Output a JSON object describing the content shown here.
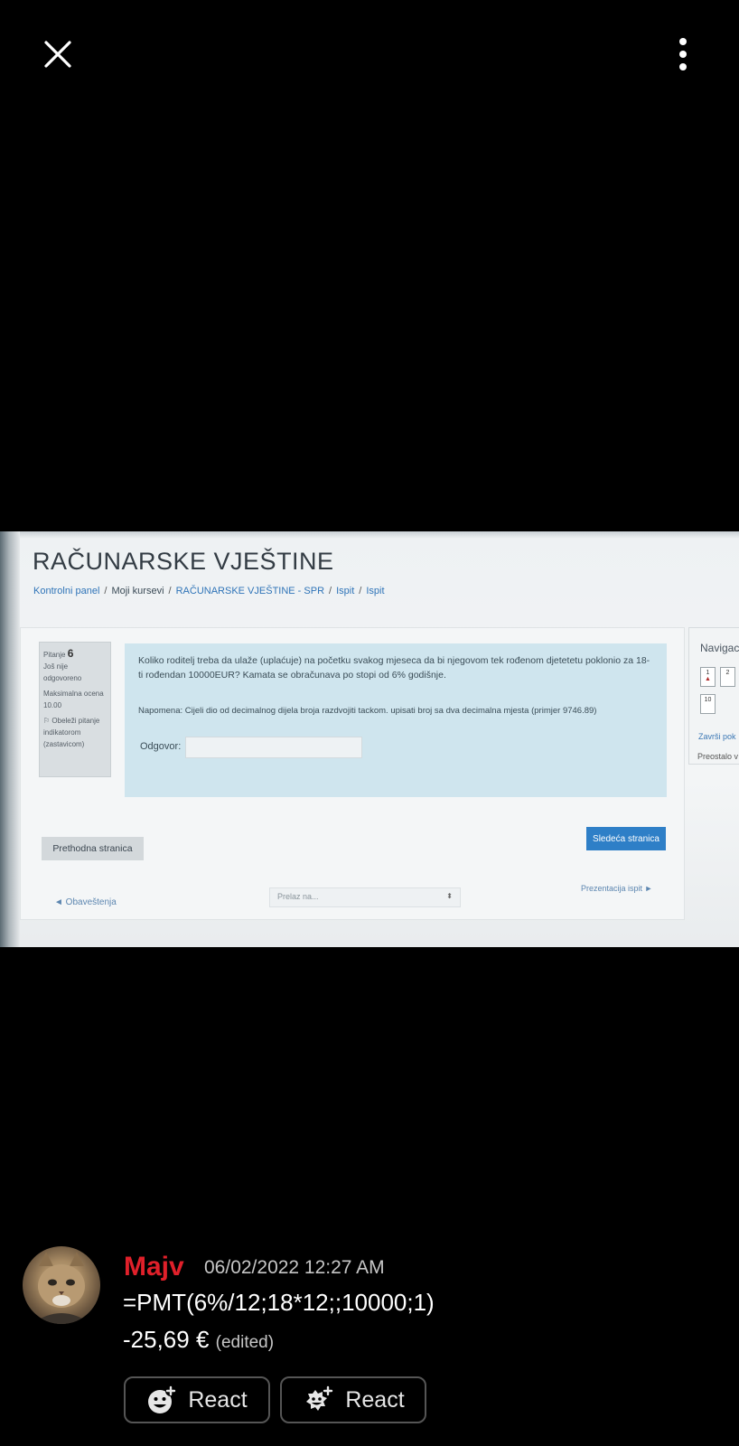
{
  "viewer": {
    "close_icon": "close-icon",
    "more_icon": "more-vertical-icon"
  },
  "screenshot": {
    "site_title": "RAČUNARSKE VJEŠTINE",
    "breadcrumb": {
      "items": [
        "Kontrolni panel",
        "Moji kursevi",
        "RAČUNARSKE VJEŠTINE - SPR",
        "Ispit",
        "Ispit"
      ],
      "separator": "/"
    },
    "question_info": {
      "label": "Pitanje",
      "number": "6",
      "status": "Još nije odgovoreno",
      "max_grade": "Maksimalna ocena 10.00",
      "flag_text": "Obeleži pitanje indikatorom (zastavicom)"
    },
    "question_text": "Koliko roditelj treba da ulaže (uplaćuje) na početku svakog mjeseca da bi njegovom tek rođenom djetetetu poklonio za 18-ti rođendan 10000EUR? Kamata se obračunava po stopi od 6% godišnje.",
    "note": "Napomena: Cijeli dio od decimalnog dijela broja razdvojiti tackom. upisati broj sa dva decimalna mjesta (primjer 9746.89)",
    "answer_label": "Odgovor:",
    "prev_button": "Prethodna stranica",
    "next_button": "Sledeća stranica",
    "prev_activity": "◄ Obaveštenja",
    "jump_placeholder": "Prelaz na...",
    "next_activity": "Prezentacija ispit ►",
    "nav": {
      "title": "Navigac",
      "buttons": [
        "1",
        "2",
        "10"
      ],
      "finish": "Završi pok",
      "remaining": "Preostalo v"
    }
  },
  "message": {
    "author": "Majv",
    "author_color": "#e0202a",
    "timestamp": "06/02/2022 12:27 AM",
    "line1": "=PMT(6%/12;18*12;;10000;1)",
    "line2": "-25,69 €",
    "edited": "(edited)"
  },
  "reactions": [
    {
      "label": "React",
      "icon": "add-reaction-icon"
    },
    {
      "label": "React",
      "icon": "add-super-reaction-icon"
    }
  ]
}
